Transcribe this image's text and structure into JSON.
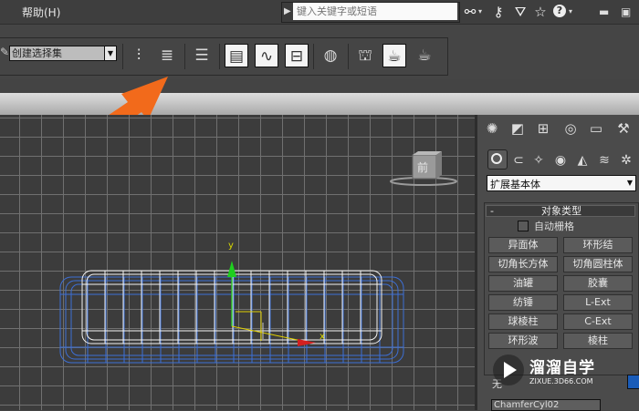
{
  "menu": {
    "fragment_label": "",
    "help_label": "帮助(H)"
  },
  "search": {
    "placeholder": "键入关键字或短语"
  },
  "top_icons": [
    "binoculars-icon",
    "key-icon",
    "exchange-icon",
    "star-icon",
    "help-icon"
  ],
  "selection_set": {
    "value": "创建选择集"
  },
  "command_panel": {
    "category": "扩展基本体",
    "rollout_title": "对象类型",
    "rollout_collapse": "-",
    "auto_grid_label": "自动栅格",
    "buttons": [
      [
        "异面体",
        "环形结"
      ],
      [
        "切角长方体",
        "切角圆柱体"
      ],
      [
        "油罐",
        "胶囊"
      ],
      [
        "纺锤",
        "L-Ext"
      ],
      [
        "球棱柱",
        "C-Ext"
      ],
      [
        "环形波",
        "棱柱"
      ]
    ],
    "name_section_label": "无",
    "object_name": "ChamferCyl02",
    "object_color": "#1a5cb8"
  },
  "viewport": {
    "axis_y_label": "y",
    "axis_x_label": "x",
    "viewcube_label": "前"
  },
  "watermark": {
    "title": "溜溜自学",
    "url": "ZIXUE.3D66.COM"
  },
  "annotation": {
    "arrow_color": "#f26a1b"
  }
}
